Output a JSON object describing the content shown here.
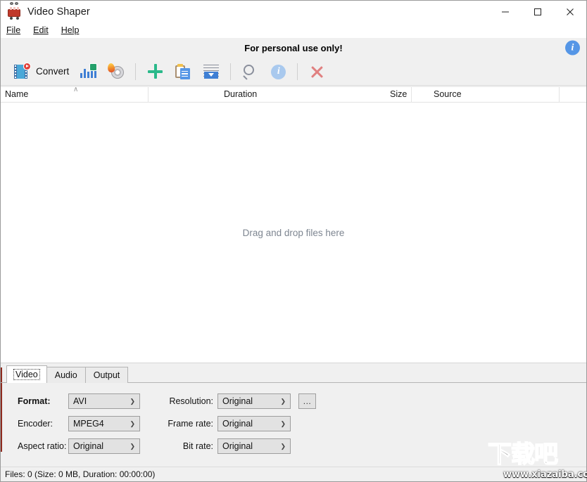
{
  "window": {
    "title": "Video Shaper",
    "app_icon": "video-camera-icon",
    "controls": {
      "minimize": "minimize-icon",
      "maximize": "maximize-icon",
      "close": "close-icon"
    }
  },
  "menubar": {
    "items": [
      {
        "label": "File",
        "accel": "F"
      },
      {
        "label": "Edit",
        "accel": "E"
      },
      {
        "label": "Help",
        "accel": "H"
      }
    ]
  },
  "banner": {
    "text": "For personal use only!",
    "info_icon": "info-icon",
    "info_glyph": "i"
  },
  "toolbar": {
    "convert_label": "Convert",
    "buttons": [
      {
        "name": "convert-button",
        "icon": "film-play-icon",
        "label": "Convert"
      },
      {
        "name": "audio-extract-button",
        "icon": "equalizer-check-icon",
        "label": ""
      },
      {
        "name": "burn-disc-button",
        "icon": "disc-flame-icon",
        "label": ""
      },
      {
        "name": "add-files-button",
        "icon": "plus-icon",
        "label": ""
      },
      {
        "name": "paste-button",
        "icon": "clipboard-document-icon",
        "label": ""
      },
      {
        "name": "load-list-button",
        "icon": "list-download-icon",
        "label": ""
      },
      {
        "name": "search-button",
        "icon": "magnifier-icon",
        "label": ""
      },
      {
        "name": "info-button",
        "icon": "info-icon",
        "label": ""
      },
      {
        "name": "remove-button",
        "icon": "close-x-icon",
        "label": ""
      }
    ]
  },
  "filelist": {
    "columns": [
      {
        "label": "Name",
        "sorted": true,
        "sort_glyph": "∧"
      },
      {
        "label": "Duration"
      },
      {
        "label": "Size"
      },
      {
        "label": "Source"
      }
    ],
    "empty_hint": "Drag and drop files here",
    "rows": []
  },
  "settings": {
    "tabs": [
      {
        "label": "Video",
        "active": true
      },
      {
        "label": "Audio",
        "active": false
      },
      {
        "label": "Output",
        "active": false
      }
    ],
    "fields": {
      "format": {
        "label": "Format:",
        "value": "AVI"
      },
      "encoder": {
        "label": "Encoder:",
        "value": "MPEG4"
      },
      "aspect_ratio": {
        "label": "Aspect ratio:",
        "value": "Original"
      },
      "resolution": {
        "label": "Resolution:",
        "value": "Original",
        "more_label": "..."
      },
      "frame_rate": {
        "label": "Frame rate:",
        "value": "Original"
      },
      "bit_rate": {
        "label": "Bit rate:",
        "value": "Original"
      }
    }
  },
  "statusbar": {
    "text": "Files: 0 (Size: 0 MB, Duration: 00:00:00)"
  },
  "watermark": {
    "logo_text": "下载吧",
    "url": "www.xiazaiba.com"
  }
}
